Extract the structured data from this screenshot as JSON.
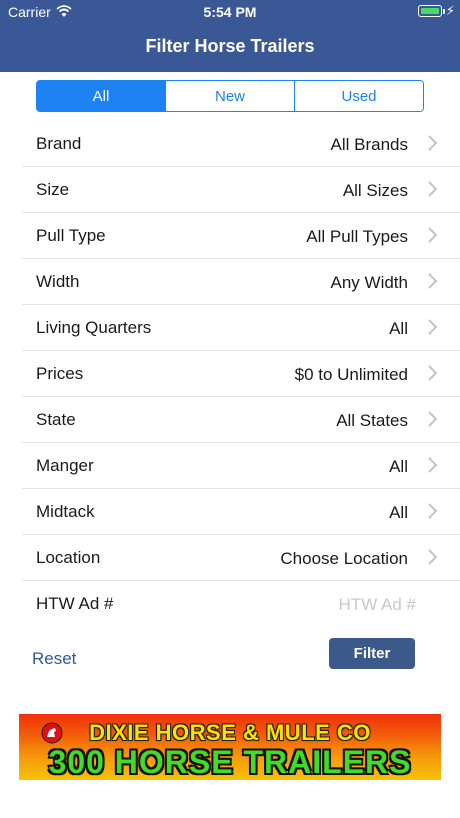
{
  "status_bar": {
    "carrier": "Carrier",
    "time": "5:54 PM"
  },
  "header": {
    "title": "Filter Horse Trailers"
  },
  "segments": [
    {
      "label": "All",
      "selected": true
    },
    {
      "label": "New",
      "selected": false
    },
    {
      "label": "Used",
      "selected": false
    }
  ],
  "filters": [
    {
      "label": "Brand",
      "value": "All Brands"
    },
    {
      "label": "Size",
      "value": "All Sizes"
    },
    {
      "label": "Pull Type",
      "value": "All Pull Types"
    },
    {
      "label": "Width",
      "value": "Any Width"
    },
    {
      "label": "Living Quarters",
      "value": "All"
    },
    {
      "label": "Prices",
      "value": "$0 to Unlimited"
    },
    {
      "label": "State",
      "value": "All States"
    },
    {
      "label": "Manger",
      "value": "All"
    },
    {
      "label": "Midtack",
      "value": "All"
    },
    {
      "label": "Location",
      "value": "Choose Location"
    }
  ],
  "ad_number": {
    "label": "HTW Ad #",
    "placeholder": "HTW Ad #",
    "value": ""
  },
  "actions": {
    "reset_label": "Reset",
    "filter_label": "Filter"
  },
  "ad_banner": {
    "line1": "DIXIE HORSE & MULE CO",
    "line2": "300 HORSE TRAILERS"
  },
  "colors": {
    "nav_bar": "#3b5896",
    "accent": "#1e82f2",
    "filter_button": "#3b5a8a",
    "link": "#2e5a9c"
  }
}
